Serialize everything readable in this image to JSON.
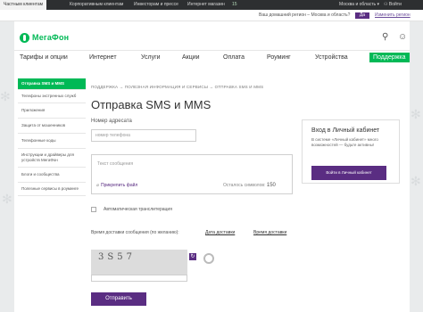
{
  "topbar": {
    "tabs": [
      "Частным клиентам",
      "Корпоративным клиентам",
      "Инвесторам и прессе",
      "Интернет магазин"
    ],
    "store_badge": "15",
    "region": "Москва и область",
    "login": "Войти"
  },
  "regionbar": {
    "question": "Ваш домашний регион – Москва и область?",
    "yes": "Да",
    "change": "Изменить регион"
  },
  "header": {
    "logo": "МегаФон",
    "nav": [
      "Тарифы и опции",
      "Интернет",
      "Услуги",
      "Акции",
      "Оплата",
      "Роуминг",
      "Устройства",
      "Поддержка"
    ]
  },
  "sidebar": {
    "items": [
      "Отправка SMS и MMS",
      "Телефоны экстренных служб",
      "Приложения",
      "Защита от мошенников",
      "Телефонные коды",
      "Инструкции и драйверы для устройств МегаФон",
      "Блоги и сообщества",
      "Полезные сервисы в роуминге"
    ]
  },
  "breadcrumb": "ПОДДЕРЖКА → ПОЛЕЗНАЯ ИНФОРМАЦИЯ И СЕРВИСЫ → ОТПРАВКА SMS И MMS",
  "page": {
    "title": "Отправка SMS и MMS",
    "phone_label": "Номер адресата",
    "phone_placeholder": "номер телефона",
    "message_placeholder": "Текст сообщения",
    "attach": "Прикрепить файл",
    "remaining_label": "Осталось символов:",
    "remaining_count": "150",
    "translit": "Автоматическая транслитерация",
    "delivery_label": "Время доставки сообщения (по желанию):",
    "delivery_date": "Дата доставки",
    "delivery_time": "Время доставки",
    "captcha_text": "3S57",
    "send": "Отправить"
  },
  "cabinet": {
    "title": "Вход в Личный кабинет",
    "text": "В системе «Личный кабинет» много возможностей — будьте активны!",
    "button": "Войти в Личный кабинет"
  },
  "colors": {
    "brand_green": "#00b956",
    "brand_purple": "#5a2d82"
  }
}
